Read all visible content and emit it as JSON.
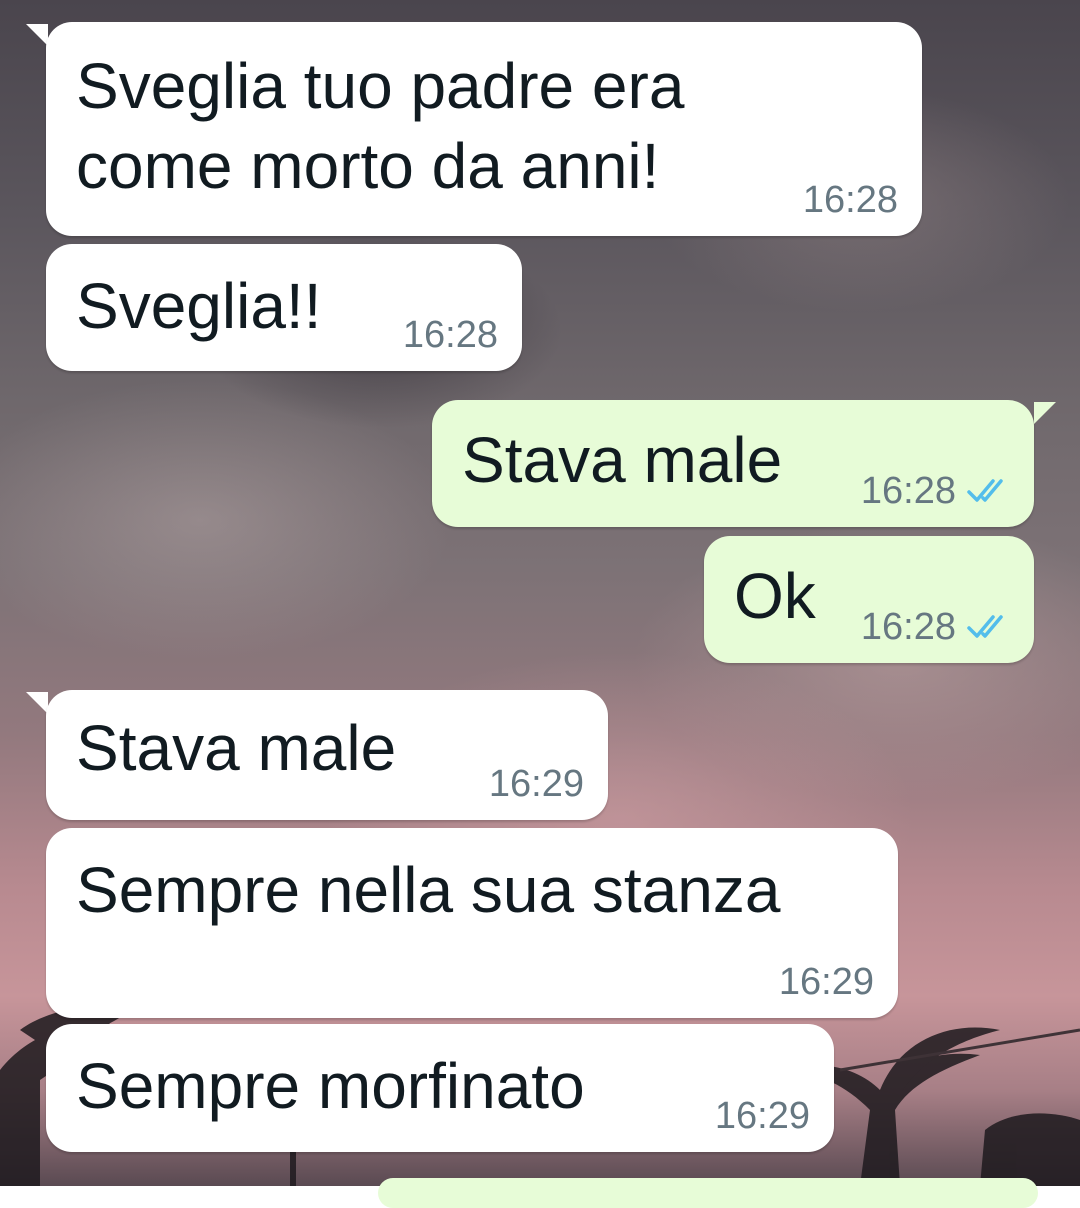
{
  "chat": {
    "messages": [
      {
        "direction": "incoming",
        "text": "Sveglia tuo padre era\ncome morto da anni!",
        "time": "16:28"
      },
      {
        "direction": "incoming",
        "text": "Sveglia!!",
        "time": "16:28"
      },
      {
        "direction": "outgoing",
        "text": "Stava male",
        "time": "16:28",
        "status": "read"
      },
      {
        "direction": "outgoing",
        "text": "Ok",
        "time": "16:28",
        "status": "read"
      },
      {
        "direction": "incoming",
        "text": "Stava male",
        "time": "16:29"
      },
      {
        "direction": "incoming",
        "text": "Sempre nella sua stanza",
        "time": "16:29"
      },
      {
        "direction": "incoming",
        "text": "Sempre morfinato",
        "time": "16:29"
      }
    ]
  },
  "icons": {
    "read_receipt": "double-check-icon"
  },
  "colors": {
    "incoming_bubble": "#ffffff",
    "outgoing_bubble": "#e7fcd7",
    "message_text": "#111b21",
    "timestamp": "#667781",
    "read_tick": "#53bdeb"
  }
}
